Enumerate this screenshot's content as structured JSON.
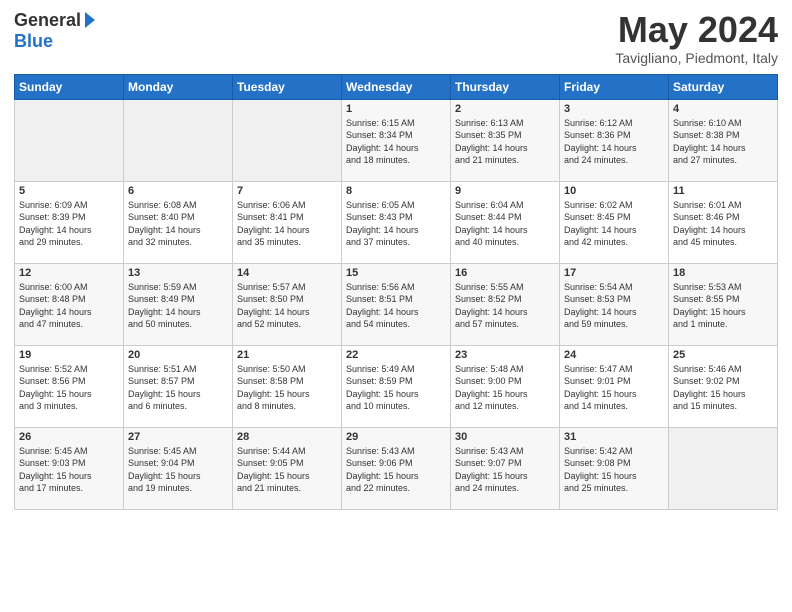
{
  "logo": {
    "general": "General",
    "blue": "Blue"
  },
  "header": {
    "month": "May 2024",
    "location": "Tavigliano, Piedmont, Italy"
  },
  "days": [
    "Sunday",
    "Monday",
    "Tuesday",
    "Wednesday",
    "Thursday",
    "Friday",
    "Saturday"
  ],
  "weeks": [
    [
      {
        "day": "",
        "info": ""
      },
      {
        "day": "",
        "info": ""
      },
      {
        "day": "",
        "info": ""
      },
      {
        "day": "1",
        "info": "Sunrise: 6:15 AM\nSunset: 8:34 PM\nDaylight: 14 hours\nand 18 minutes."
      },
      {
        "day": "2",
        "info": "Sunrise: 6:13 AM\nSunset: 8:35 PM\nDaylight: 14 hours\nand 21 minutes."
      },
      {
        "day": "3",
        "info": "Sunrise: 6:12 AM\nSunset: 8:36 PM\nDaylight: 14 hours\nand 24 minutes."
      },
      {
        "day": "4",
        "info": "Sunrise: 6:10 AM\nSunset: 8:38 PM\nDaylight: 14 hours\nand 27 minutes."
      }
    ],
    [
      {
        "day": "5",
        "info": "Sunrise: 6:09 AM\nSunset: 8:39 PM\nDaylight: 14 hours\nand 29 minutes."
      },
      {
        "day": "6",
        "info": "Sunrise: 6:08 AM\nSunset: 8:40 PM\nDaylight: 14 hours\nand 32 minutes."
      },
      {
        "day": "7",
        "info": "Sunrise: 6:06 AM\nSunset: 8:41 PM\nDaylight: 14 hours\nand 35 minutes."
      },
      {
        "day": "8",
        "info": "Sunrise: 6:05 AM\nSunset: 8:43 PM\nDaylight: 14 hours\nand 37 minutes."
      },
      {
        "day": "9",
        "info": "Sunrise: 6:04 AM\nSunset: 8:44 PM\nDaylight: 14 hours\nand 40 minutes."
      },
      {
        "day": "10",
        "info": "Sunrise: 6:02 AM\nSunset: 8:45 PM\nDaylight: 14 hours\nand 42 minutes."
      },
      {
        "day": "11",
        "info": "Sunrise: 6:01 AM\nSunset: 8:46 PM\nDaylight: 14 hours\nand 45 minutes."
      }
    ],
    [
      {
        "day": "12",
        "info": "Sunrise: 6:00 AM\nSunset: 8:48 PM\nDaylight: 14 hours\nand 47 minutes."
      },
      {
        "day": "13",
        "info": "Sunrise: 5:59 AM\nSunset: 8:49 PM\nDaylight: 14 hours\nand 50 minutes."
      },
      {
        "day": "14",
        "info": "Sunrise: 5:57 AM\nSunset: 8:50 PM\nDaylight: 14 hours\nand 52 minutes."
      },
      {
        "day": "15",
        "info": "Sunrise: 5:56 AM\nSunset: 8:51 PM\nDaylight: 14 hours\nand 54 minutes."
      },
      {
        "day": "16",
        "info": "Sunrise: 5:55 AM\nSunset: 8:52 PM\nDaylight: 14 hours\nand 57 minutes."
      },
      {
        "day": "17",
        "info": "Sunrise: 5:54 AM\nSunset: 8:53 PM\nDaylight: 14 hours\nand 59 minutes."
      },
      {
        "day": "18",
        "info": "Sunrise: 5:53 AM\nSunset: 8:55 PM\nDaylight: 15 hours\nand 1 minute."
      }
    ],
    [
      {
        "day": "19",
        "info": "Sunrise: 5:52 AM\nSunset: 8:56 PM\nDaylight: 15 hours\nand 3 minutes."
      },
      {
        "day": "20",
        "info": "Sunrise: 5:51 AM\nSunset: 8:57 PM\nDaylight: 15 hours\nand 6 minutes."
      },
      {
        "day": "21",
        "info": "Sunrise: 5:50 AM\nSunset: 8:58 PM\nDaylight: 15 hours\nand 8 minutes."
      },
      {
        "day": "22",
        "info": "Sunrise: 5:49 AM\nSunset: 8:59 PM\nDaylight: 15 hours\nand 10 minutes."
      },
      {
        "day": "23",
        "info": "Sunrise: 5:48 AM\nSunset: 9:00 PM\nDaylight: 15 hours\nand 12 minutes."
      },
      {
        "day": "24",
        "info": "Sunrise: 5:47 AM\nSunset: 9:01 PM\nDaylight: 15 hours\nand 14 minutes."
      },
      {
        "day": "25",
        "info": "Sunrise: 5:46 AM\nSunset: 9:02 PM\nDaylight: 15 hours\nand 15 minutes."
      }
    ],
    [
      {
        "day": "26",
        "info": "Sunrise: 5:45 AM\nSunset: 9:03 PM\nDaylight: 15 hours\nand 17 minutes."
      },
      {
        "day": "27",
        "info": "Sunrise: 5:45 AM\nSunset: 9:04 PM\nDaylight: 15 hours\nand 19 minutes."
      },
      {
        "day": "28",
        "info": "Sunrise: 5:44 AM\nSunset: 9:05 PM\nDaylight: 15 hours\nand 21 minutes."
      },
      {
        "day": "29",
        "info": "Sunrise: 5:43 AM\nSunset: 9:06 PM\nDaylight: 15 hours\nand 22 minutes."
      },
      {
        "day": "30",
        "info": "Sunrise: 5:43 AM\nSunset: 9:07 PM\nDaylight: 15 hours\nand 24 minutes."
      },
      {
        "day": "31",
        "info": "Sunrise: 5:42 AM\nSunset: 9:08 PM\nDaylight: 15 hours\nand 25 minutes."
      },
      {
        "day": "",
        "info": ""
      }
    ]
  ]
}
